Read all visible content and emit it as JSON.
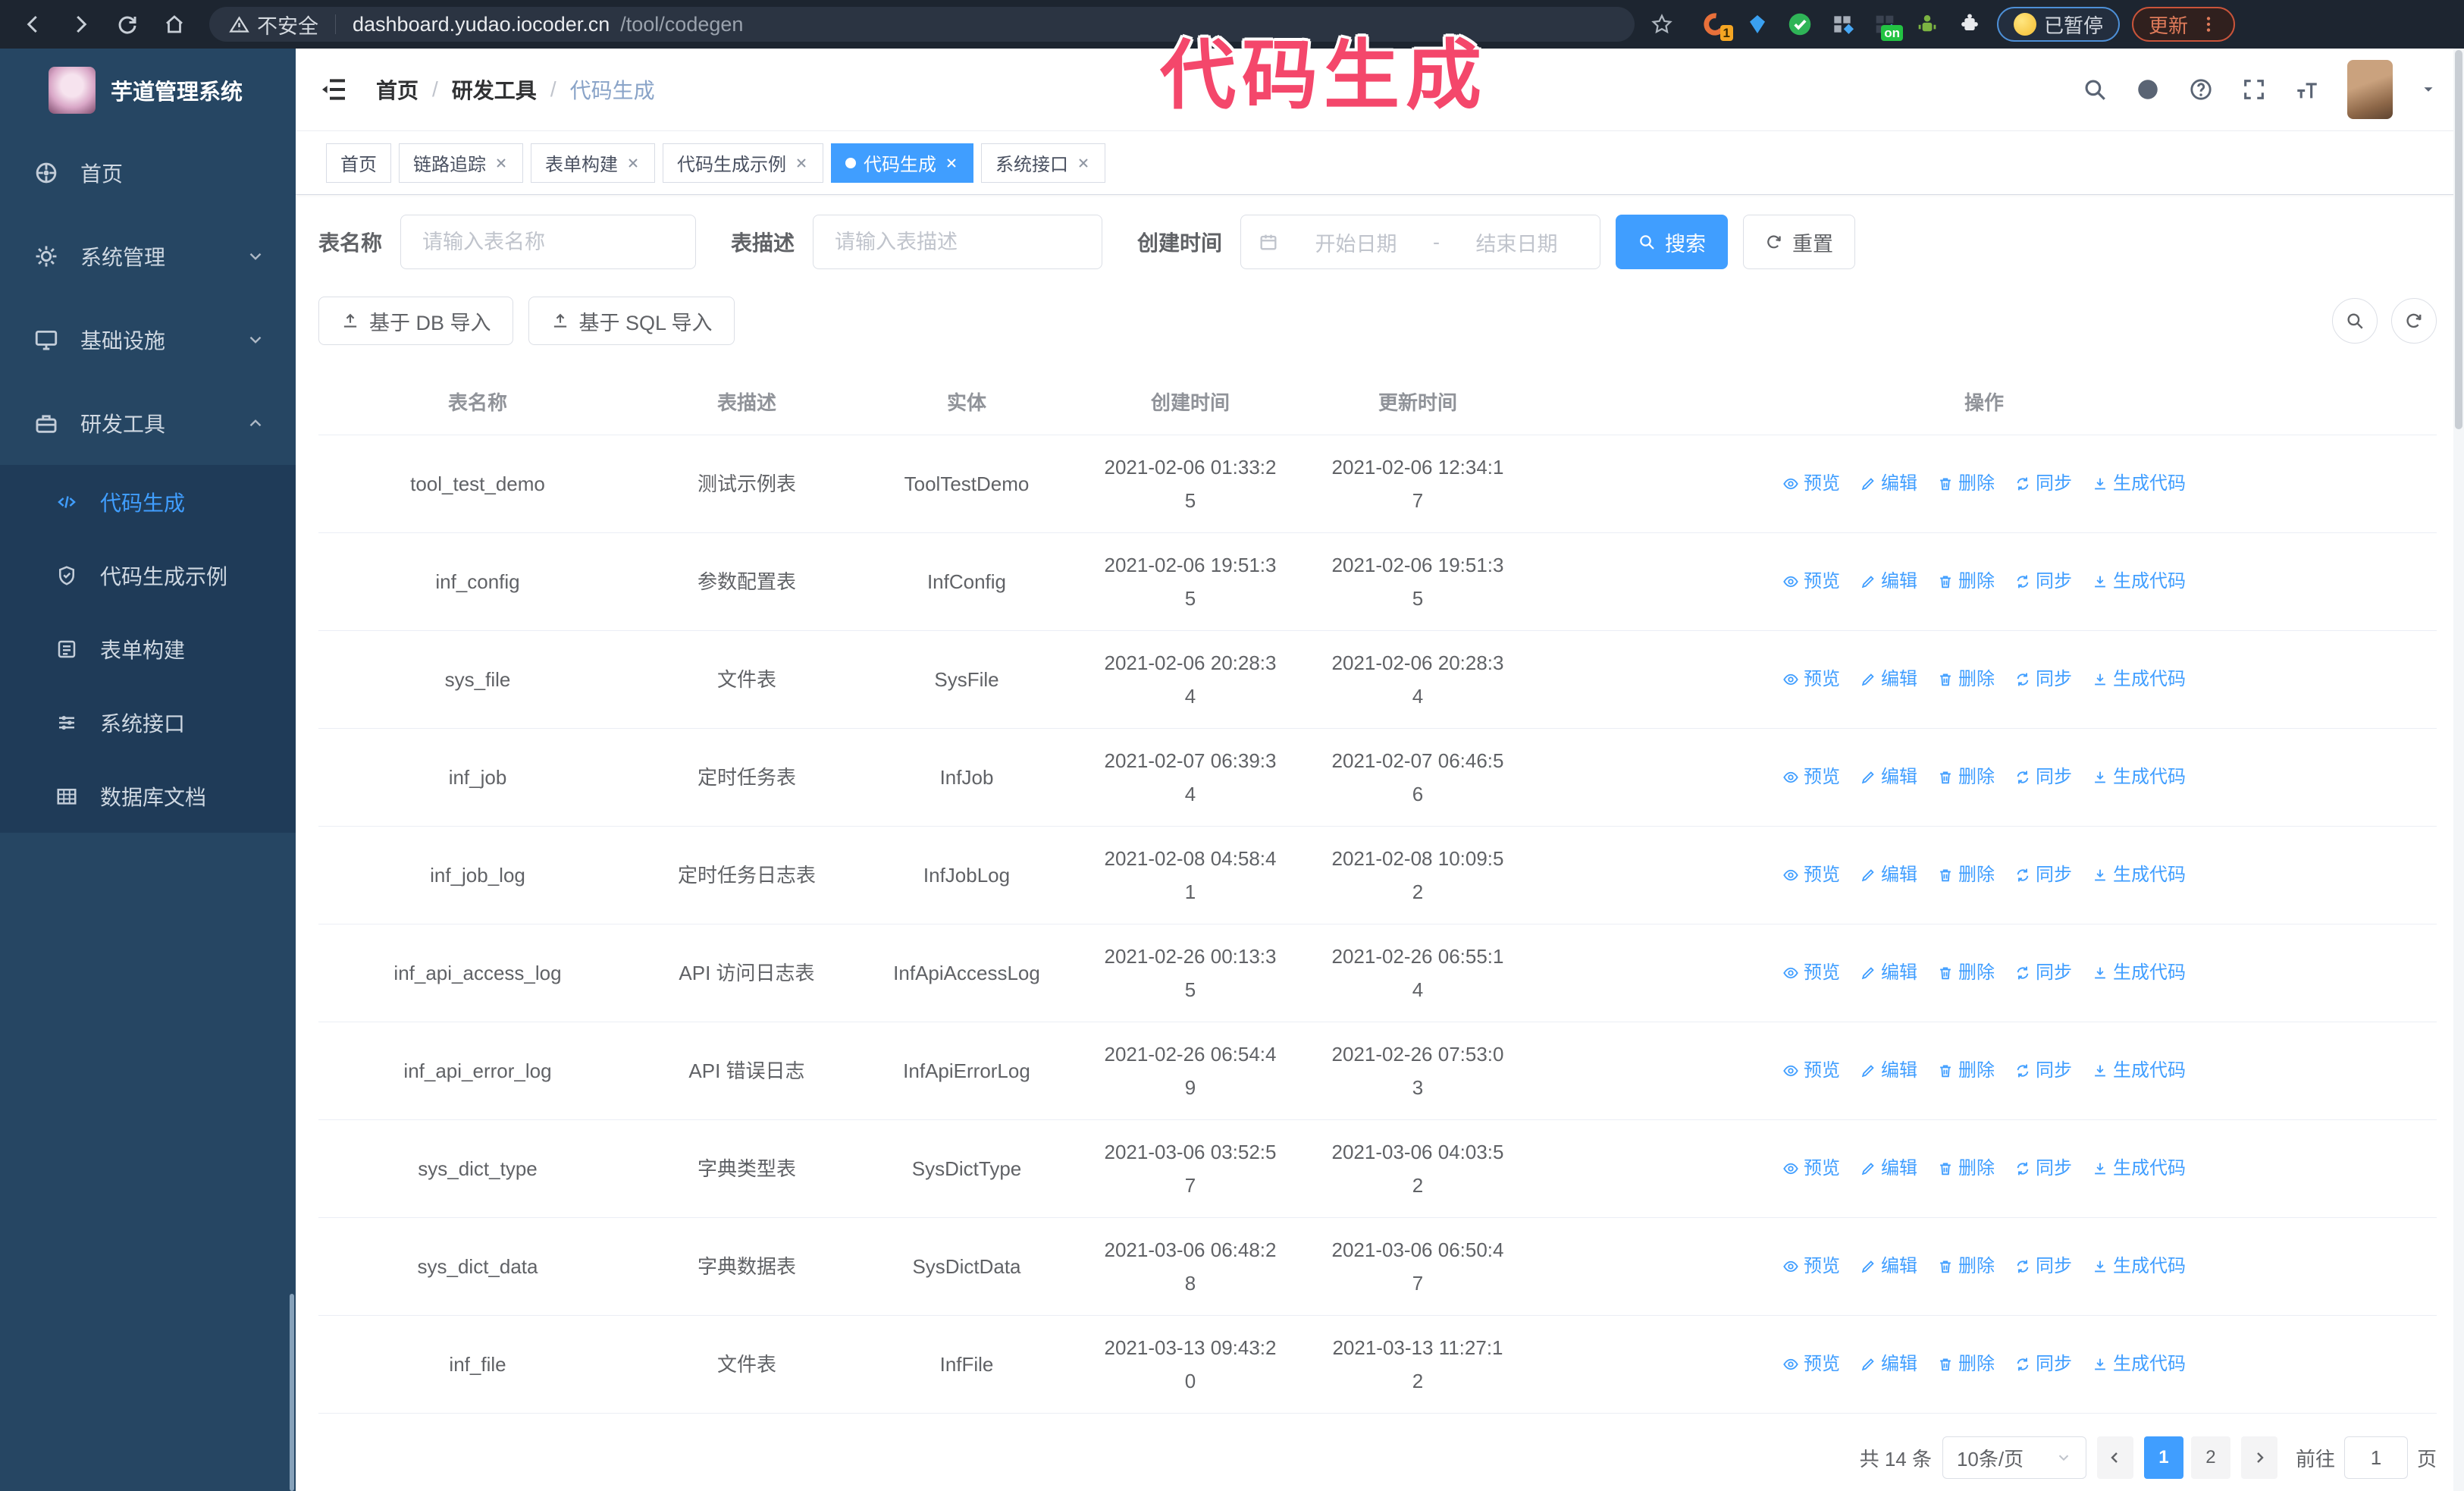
{
  "colors": {
    "accent": "#409EFF",
    "sidebar": "#264663",
    "submenu": "#1f3b58",
    "chrome": "#1d2530",
    "annotation": "#f4476b"
  },
  "annotation": {
    "text": "代码生成"
  },
  "browser": {
    "security_label": "不安全",
    "url_host": "dashboard.yudao.iocoder.cn",
    "url_path": "/tool/codegen",
    "extension_badge": "1",
    "extension_on_badge": "on",
    "paused_badge": "已暂停",
    "update_button": "更新"
  },
  "sidebar": {
    "app_title": "芋道管理系统",
    "menu": [
      {
        "label": "首页",
        "icon": "dashboard-icon",
        "chevron": ""
      },
      {
        "label": "系统管理",
        "icon": "gear-icon",
        "chevron": "down"
      },
      {
        "label": "基础设施",
        "icon": "monitor-icon",
        "chevron": "down"
      },
      {
        "label": "研发工具",
        "icon": "toolbox-icon",
        "chevron": "up"
      }
    ],
    "submenu": [
      {
        "label": "代码生成",
        "icon": "code-icon",
        "active": true
      },
      {
        "label": "代码生成示例",
        "icon": "shield-check-icon",
        "active": false
      },
      {
        "label": "表单构建",
        "icon": "form-icon",
        "active": false
      },
      {
        "label": "系统接口",
        "icon": "sliders-icon",
        "active": false
      },
      {
        "label": "数据库文档",
        "icon": "table-grid-icon",
        "active": false
      }
    ]
  },
  "header": {
    "breadcrumb": [
      "首页",
      "研发工具",
      "代码生成"
    ],
    "breadcrumb_separator": "/"
  },
  "tabs": [
    {
      "label": "首页",
      "closable": false,
      "active": false
    },
    {
      "label": "链路追踪",
      "closable": true,
      "active": false
    },
    {
      "label": "表单构建",
      "closable": true,
      "active": false
    },
    {
      "label": "代码生成示例",
      "closable": true,
      "active": false
    },
    {
      "label": "代码生成",
      "closable": true,
      "active": true
    },
    {
      "label": "系统接口",
      "closable": true,
      "active": false
    }
  ],
  "filters": {
    "table_name_label": "表名称",
    "table_name_placeholder": "请输入表名称",
    "table_desc_label": "表描述",
    "table_desc_placeholder": "请输入表描述",
    "create_time_label": "创建时间",
    "date_start_placeholder": "开始日期",
    "date_separator": "-",
    "date_end_placeholder": "结束日期",
    "search_button": "搜索",
    "reset_button": "重置"
  },
  "toolbar": {
    "import_db_button": "基于 DB 导入",
    "import_sql_button": "基于 SQL 导入"
  },
  "table": {
    "columns": [
      "表名称",
      "表描述",
      "实体",
      "创建时间",
      "更新时间",
      "操作"
    ],
    "actions": [
      {
        "label": "预览",
        "icon": "eye-icon"
      },
      {
        "label": "编辑",
        "icon": "pencil-icon"
      },
      {
        "label": "删除",
        "icon": "trash-icon"
      },
      {
        "label": "同步",
        "icon": "sync-icon"
      },
      {
        "label": "生成代码",
        "icon": "download-icon"
      }
    ],
    "rows": [
      {
        "name": "tool_test_demo",
        "desc": "测试示例表",
        "entity": "ToolTestDemo",
        "created": "2021-02-06 01:33:25",
        "updated": "2021-02-06 12:34:17"
      },
      {
        "name": "inf_config",
        "desc": "参数配置表",
        "entity": "InfConfig",
        "created": "2021-02-06 19:51:35",
        "updated": "2021-02-06 19:51:35"
      },
      {
        "name": "sys_file",
        "desc": "文件表",
        "entity": "SysFile",
        "created": "2021-02-06 20:28:34",
        "updated": "2021-02-06 20:28:34"
      },
      {
        "name": "inf_job",
        "desc": "定时任务表",
        "entity": "InfJob",
        "created": "2021-02-07 06:39:34",
        "updated": "2021-02-07 06:46:56"
      },
      {
        "name": "inf_job_log",
        "desc": "定时任务日志表",
        "entity": "InfJobLog",
        "created": "2021-02-08 04:58:41",
        "updated": "2021-02-08 10:09:52"
      },
      {
        "name": "inf_api_access_log",
        "desc": "API 访问日志表",
        "entity": "InfApiAccessLog",
        "created": "2021-02-26 00:13:35",
        "updated": "2021-02-26 06:55:14"
      },
      {
        "name": "inf_api_error_log",
        "desc": "API 错误日志",
        "entity": "InfApiErrorLog",
        "created": "2021-02-26 06:54:49",
        "updated": "2021-02-26 07:53:03"
      },
      {
        "name": "sys_dict_type",
        "desc": "字典类型表",
        "entity": "SysDictType",
        "created": "2021-03-06 03:52:57",
        "updated": "2021-03-06 04:03:52"
      },
      {
        "name": "sys_dict_data",
        "desc": "字典数据表",
        "entity": "SysDictData",
        "created": "2021-03-06 06:48:28",
        "updated": "2021-03-06 06:50:47"
      },
      {
        "name": "inf_file",
        "desc": "文件表",
        "entity": "InfFile",
        "created": "2021-03-13 09:43:20",
        "updated": "2021-03-13 11:27:12"
      }
    ]
  },
  "pagination": {
    "total_text": "共 14 条",
    "page_size": "10条/页",
    "pages": [
      "1",
      "2"
    ],
    "active_page": "1",
    "goto_label": "前往",
    "goto_value": "1",
    "goto_suffix": "页"
  }
}
